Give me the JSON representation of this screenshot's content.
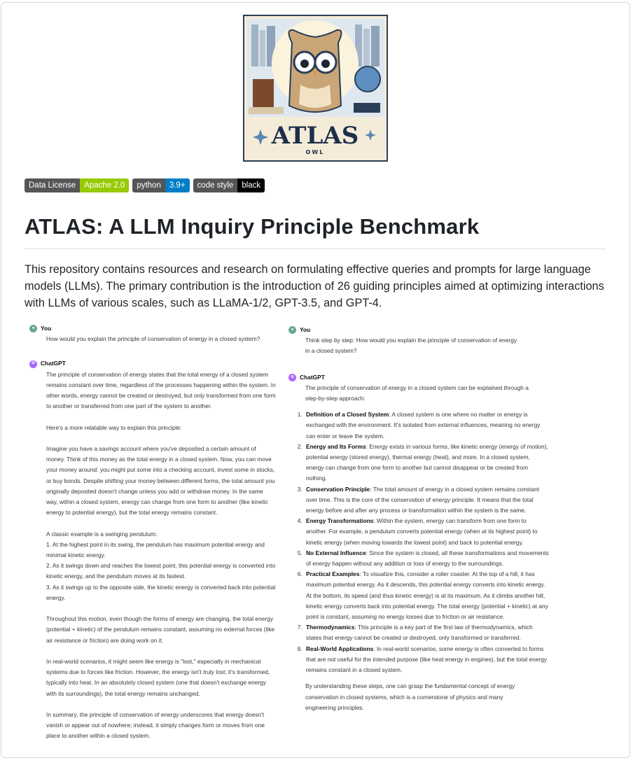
{
  "logo": {
    "title": "ATLAS",
    "subtitle": "OWL"
  },
  "badges": [
    {
      "label": "Data License",
      "value": "Apache 2.0",
      "color": "#97ca00"
    },
    {
      "label": "python",
      "value": "3.9+",
      "color": "#007ec6"
    },
    {
      "label": "code style",
      "value": "black",
      "color": "#000000"
    }
  ],
  "title": "ATLAS: A LLM Inquiry Principle Benchmark",
  "intro": "This repository contains resources and research on formulating effective queries and prompts for large language models (LLMs). The primary contribution is the introduction of 26 guiding principles aimed at optimizing interactions with LLMs of various scales, such as LLaMA-1/2, GPT-3.5, and GPT-4.",
  "left": {
    "user_role": "You",
    "question": "How would you explain the principle of conservation of energy in a closed system?",
    "assistant_role": "ChatGPT",
    "paragraphs": [
      "The principle of conservation of energy states that the total energy of a closed system remains constant over time, regardless of the processes happening within the system. In other words, energy cannot be created or destroyed, but only transformed from one form to another or transferred from one part of the system to another.",
      "Here's a more relatable way to explain this principle:",
      "Imagine you have a savings account where you've deposited a certain amount of money. Think of this money as the total energy in a closed system. Now, you can move your money around: you might put some into a checking account, invest some in stocks, or buy bonds. Despite shifting your money between different forms, the total amount you originally deposited doesn't change unless you add or withdraw money. In the same way, within a closed system, energy can change from one form to another (like kinetic energy to potential energy), but the total energy remains constant.",
      "A classic example is a swinging pendulum:\n1. At the highest point in its swing, the pendulum has maximum potential energy and minimal kinetic energy.\n2. As it swings down and reaches the lowest point, this potential energy is converted into kinetic energy, and the pendulum moves at its fastest.\n3. As it swings up to the opposite side, the kinetic energy is converted back into potential energy.",
      "Throughout this motion, even though the forms of energy are changing, the total energy (potential + kinetic) of the pendulum remains constant, assuming no external forces (like air resistance or friction) are doing work on it.",
      "In real-world scenarios, it might seem like energy is \"lost,\" especially in mechanical systems due to forces like friction. However, the energy isn't truly lost; it's transformed, typically into heat. In an absolutely closed system (one that doesn't exchange energy with its surroundings), the total energy remains unchanged.",
      "In summary, the principle of conservation of energy underscores that energy doesn't vanish or appear out of nowhere; instead, it simply changes form or moves from one place to another within a closed system."
    ]
  },
  "right": {
    "user_role": "You",
    "question": "Think step by step: How would you explain the principle of conservation of energy in a closed system?",
    "assistant_role": "ChatGPT",
    "lead": "The principle of conservation of energy in a closed system can be explained through a step-by-step approach:",
    "steps": [
      {
        "title": "Definition of a Closed System",
        "text": ": A closed system is one where no matter or energy is exchanged with the environment. It's isolated from external influences, meaning no energy can enter or leave the system."
      },
      {
        "title": "Energy and Its Forms",
        "text": ": Energy exists in various forms, like kinetic energy (energy of motion), potential energy (stored energy), thermal energy (heat), and more. In a closed system, energy can change from one form to another but cannot disappear or be created from nothing."
      },
      {
        "title": "Conservation Principle",
        "text": ": The total amount of energy in a closed system remains constant over time. This is the core of the conservation of energy principle. It means that the total energy before and after any process or transformation within the system is the same."
      },
      {
        "title": "Energy Transformations",
        "text": ": Within the system, energy can transform from one form to another. For example, a pendulum converts potential energy (when at its highest point) to kinetic energy (when moving towards the lowest point) and back to potential energy."
      },
      {
        "title": "No External Influence",
        "text": ": Since the system is closed, all these transformations and movements of energy happen without any addition or loss of energy to the surroundings."
      },
      {
        "title": "Practical Examples",
        "text": ": To visualize this, consider a roller coaster. At the top of a hill, it has maximum potential energy. As it descends, this potential energy converts into kinetic energy. At the bottom, its speed (and thus kinetic energy) is at its maximum. As it climbs another hill, kinetic energy converts back into potential energy. The total energy (potential + kinetic) at any point is constant, assuming no energy losses due to friction or air resistance."
      },
      {
        "title": "Thermodynamics",
        "text": ": This principle is a key part of the first law of thermodynamics, which states that energy cannot be created or destroyed, only transformed or transferred."
      },
      {
        "title": "Real-World Applications",
        "text": ": In real-world scenarios, some energy is often converted to forms that are not useful for the intended purpose (like heat energy in engines), but the total energy remains constant in a closed system."
      }
    ],
    "conclusion": "By understanding these steps, one can grasp the fundamental concept of energy conservation in closed systems, which is a cornerstone of physics and many engineering principles."
  }
}
